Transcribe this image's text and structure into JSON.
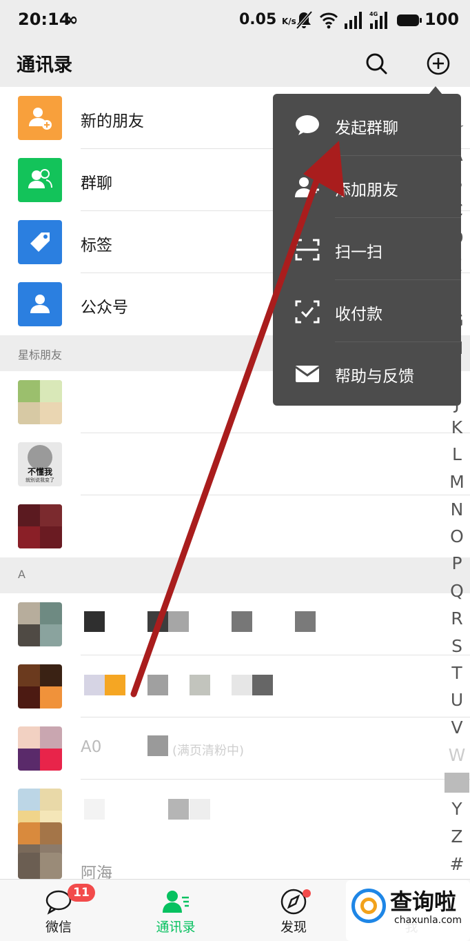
{
  "status_bar": {
    "time": "20:14",
    "infinity": "∞",
    "network_speed": "0.05",
    "network_unit": "K/s",
    "battery": "100"
  },
  "nav": {
    "title": "通讯录"
  },
  "function_rows": [
    {
      "label": "新的朋友",
      "color": "#f8a03c"
    },
    {
      "label": "群聊",
      "color": "#13c35a"
    },
    {
      "label": "标签",
      "color": "#2b7fe0"
    },
    {
      "label": "公众号",
      "color": "#2b7fe0"
    }
  ],
  "sections": {
    "starred": "星标朋友",
    "a": "A"
  },
  "starred_contacts": [
    {
      "avatar_text": ""
    },
    {
      "avatar_text": "不懂我",
      "avatar_subtext": "就别说我变了"
    },
    {
      "avatar_text": ""
    }
  ],
  "a_contacts": [
    {
      "name": ""
    },
    {
      "name": ""
    },
    {
      "name": "A0",
      "suffix": "(满页清粉中)"
    },
    {
      "name": ""
    },
    {
      "name": "阿海"
    }
  ],
  "index_letters": [
    "☆",
    "A",
    "B",
    "C",
    "D",
    "E",
    "F",
    "G",
    "H",
    "I",
    "J",
    "K",
    "L",
    "M",
    "N",
    "O",
    "P",
    "Q",
    "R",
    "S",
    "T",
    "U",
    "V",
    "W",
    "X",
    "Y",
    "Z",
    "#"
  ],
  "popup_menu": [
    {
      "label": "发起群聊",
      "icon": "chat-bubble-icon"
    },
    {
      "label": "添加朋友",
      "icon": "add-person-icon"
    },
    {
      "label": "扫一扫",
      "icon": "scan-icon"
    },
    {
      "label": "收付款",
      "icon": "payment-icon"
    },
    {
      "label": "帮助与反馈",
      "icon": "mail-icon"
    }
  ],
  "tabs": [
    {
      "label": "微信",
      "badge": "11"
    },
    {
      "label": "通讯录",
      "active_color": "#07c160"
    },
    {
      "label": "发现"
    },
    {
      "label": "我"
    }
  ],
  "watermark": {
    "text": "查询啦",
    "url": "chaxunla.com"
  }
}
